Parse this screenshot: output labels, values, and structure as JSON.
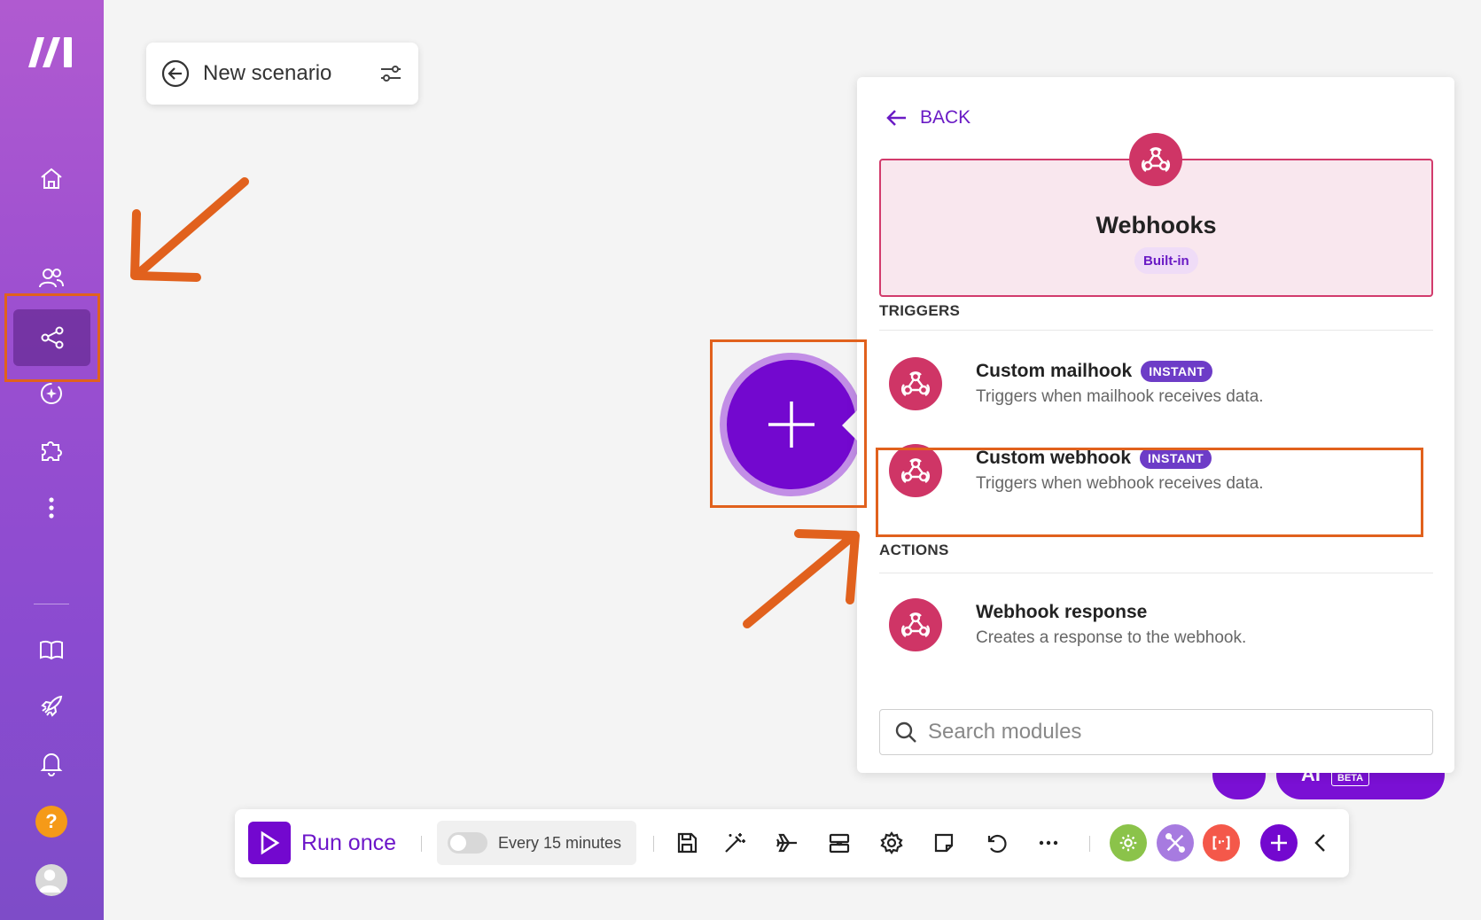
{
  "app": {
    "title": "New scenario"
  },
  "sidebar": {
    "items": [
      {
        "name": "home-icon"
      },
      {
        "name": "team-icon"
      },
      {
        "name": "scenarios-icon",
        "active": true
      },
      {
        "name": "ai-agents-icon"
      },
      {
        "name": "apps-icon"
      },
      {
        "name": "more-icon"
      },
      {
        "name": "docs-icon"
      },
      {
        "name": "launch-icon"
      },
      {
        "name": "notifications-icon"
      },
      {
        "name": "help-icon",
        "label": "?"
      },
      {
        "name": "avatar"
      }
    ]
  },
  "panel": {
    "back_label": "BACK",
    "app_name": "Webhooks",
    "app_badge": "Built-in",
    "triggers_heading": "TRIGGERS",
    "actions_heading": "ACTIONS",
    "triggers": [
      {
        "title": "Custom mailhook",
        "badge": "INSTANT",
        "desc": "Triggers when mailhook receives data."
      },
      {
        "title": "Custom webhook",
        "badge": "INSTANT",
        "desc": "Triggers when webhook receives data."
      }
    ],
    "actions": [
      {
        "title": "Webhook response",
        "desc": "Creates a response to the webhook."
      }
    ],
    "search_placeholder": "Search modules"
  },
  "floating": {
    "ai_label": "AI",
    "beta_label": "BETA"
  },
  "toolbar": {
    "run_label": "Run once",
    "schedule_label": "Every 15 minutes",
    "schedule_enabled": false
  },
  "colors": {
    "accent": "#7308cf",
    "webhook": "#cf3566",
    "annotation": "#e1611d"
  }
}
